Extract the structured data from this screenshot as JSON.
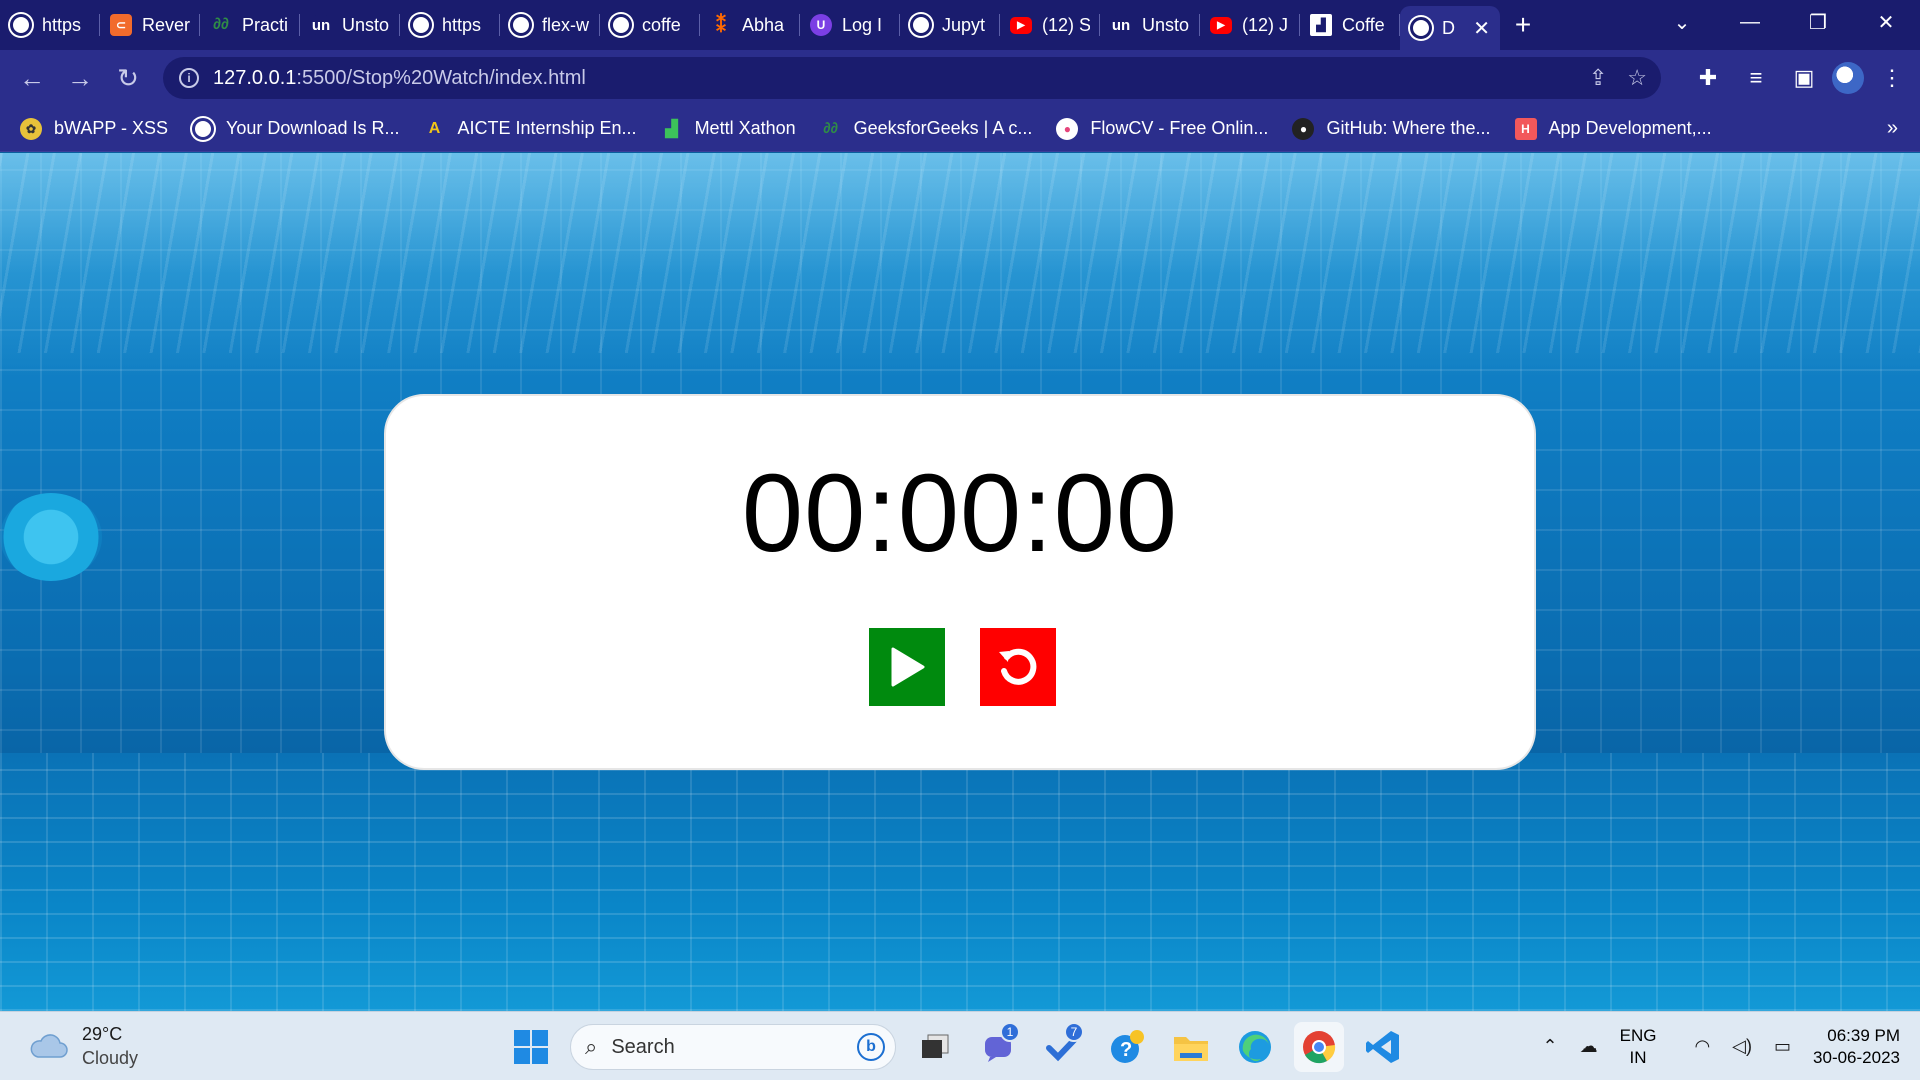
{
  "browser": {
    "tabs": [
      {
        "label": "https",
        "icon": "globe-icon"
      },
      {
        "label": "Rever",
        "icon": "reverse-icon"
      },
      {
        "label": "Practi",
        "icon": "gfg-icon"
      },
      {
        "label": "Unsto",
        "icon": "unstop-icon"
      },
      {
        "label": "https",
        "icon": "globe-icon"
      },
      {
        "label": "flex-w",
        "icon": "globe-icon"
      },
      {
        "label": "coffe",
        "icon": "globe-icon"
      },
      {
        "label": "Abha",
        "icon": "abha-icon"
      },
      {
        "label": "Log I",
        "icon": "login-icon"
      },
      {
        "label": "Jupyt",
        "icon": "globe-icon"
      },
      {
        "label": "(12) S",
        "icon": "youtube-icon"
      },
      {
        "label": "Unsto",
        "icon": "unstop-icon"
      },
      {
        "label": "(12) J",
        "icon": "youtube-icon"
      },
      {
        "label": "Coffe",
        "icon": "coffee-icon"
      },
      {
        "label": "D",
        "icon": "globe-icon",
        "active": true
      }
    ],
    "new_tab": "+",
    "address": {
      "host": "127.0.0.1",
      "path": ":5500/Stop%20Watch/index.html"
    },
    "bookmarks": [
      {
        "label": "bWAPP - XSS",
        "icon": "bee-icon"
      },
      {
        "label": "Your Download Is R...",
        "icon": "globe-icon"
      },
      {
        "label": "AICTE Internship En...",
        "icon": "aicte-icon"
      },
      {
        "label": "Mettl Xathon",
        "icon": "mettl-icon"
      },
      {
        "label": "GeeksforGeeks | A c...",
        "icon": "gfg-icon"
      },
      {
        "label": "FlowCV - Free Onlin...",
        "icon": "flowcv-icon"
      },
      {
        "label": "GitHub: Where the...",
        "icon": "github-icon"
      },
      {
        "label": "App Development,...",
        "icon": "h-icon"
      }
    ],
    "bookmarks_more": "»"
  },
  "stopwatch": {
    "time": "00:00:00",
    "play_color": "#008a0e",
    "reset_color": "#ff0000"
  },
  "taskbar": {
    "weather": {
      "temp": "29°C",
      "condition": "Cloudy"
    },
    "search_placeholder": "Search",
    "teams_badge": "1",
    "todo_badge": "7",
    "language": {
      "line1": "ENG",
      "line2": "IN"
    },
    "clock": {
      "time": "06:39 PM",
      "date": "30-06-2023"
    }
  }
}
